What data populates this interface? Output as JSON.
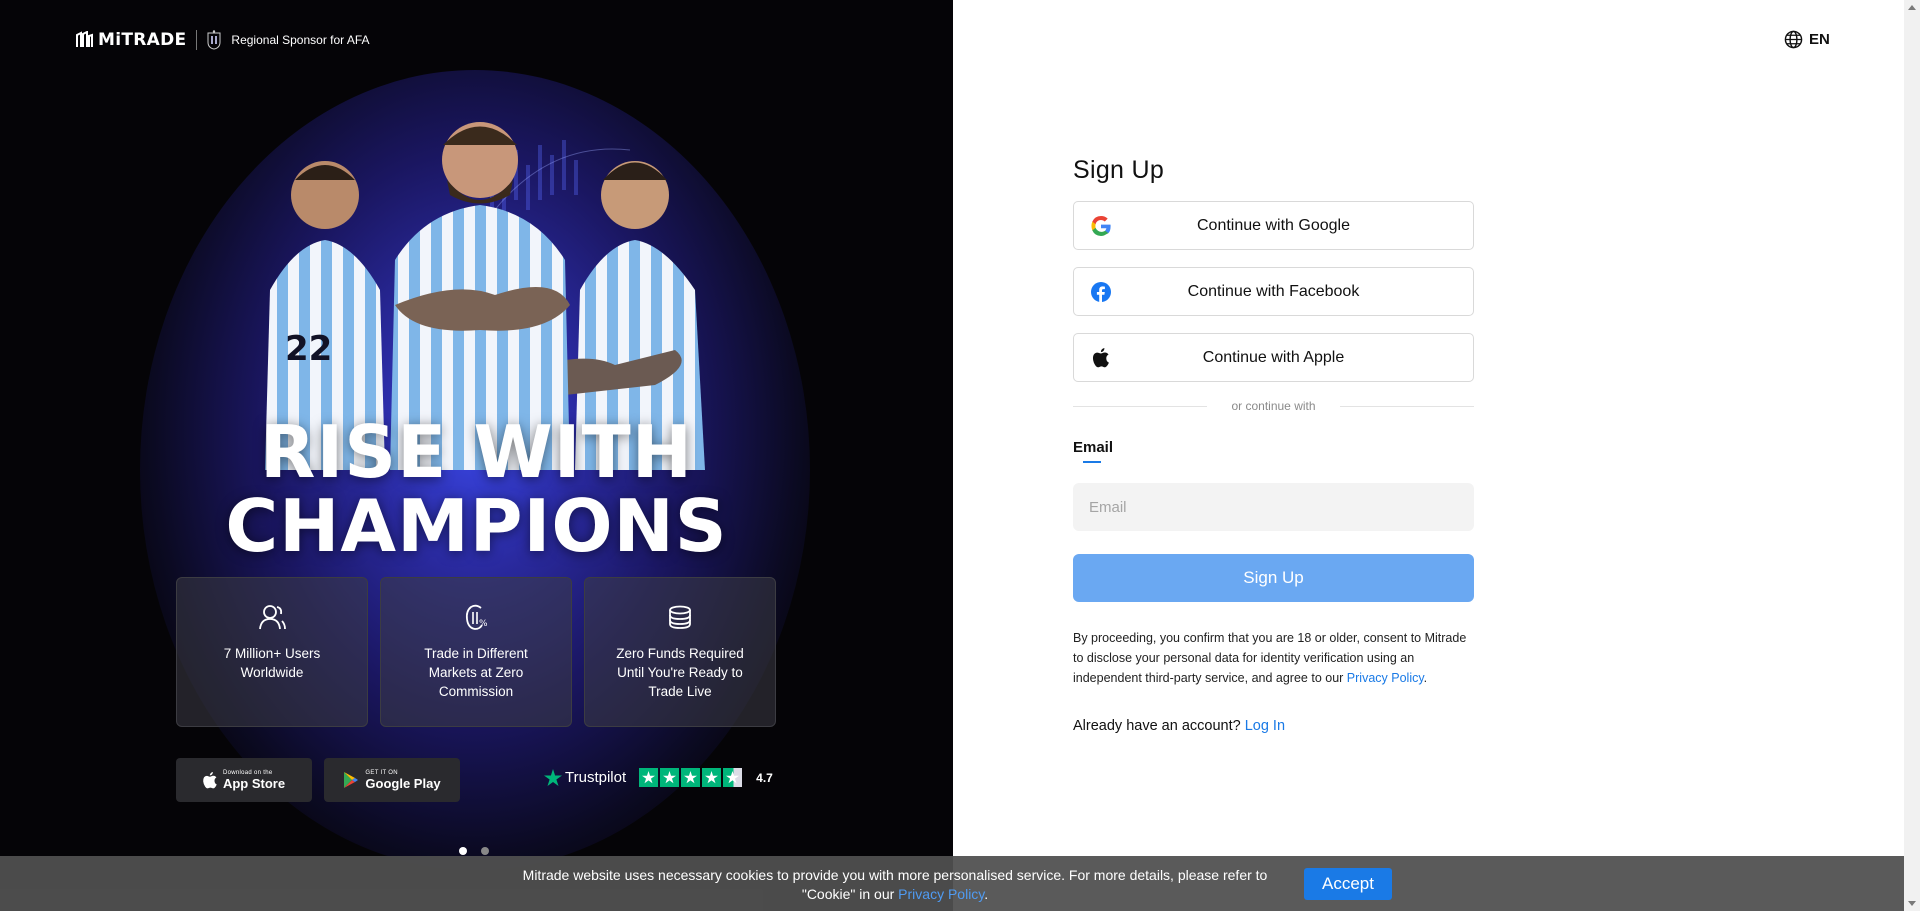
{
  "hero": {
    "brand_name": "MiTRADE",
    "sponsor_text": "Regional Sponsor for AFA",
    "headline_line1": "RISE WITH",
    "headline_line2": "CHAMPIONS",
    "features": [
      {
        "icon": "users-icon",
        "text": "7 Million+ Users Worldwide"
      },
      {
        "icon": "zero-commission-icon",
        "text": "Trade in Different Markets at Zero Commission"
      },
      {
        "icon": "coin-stack-icon",
        "text": "Zero Funds Required Until You're Ready to Trade Live"
      }
    ],
    "app_store": {
      "small": "Download on the",
      "big": "App Store"
    },
    "google_play": {
      "small": "GET IT ON",
      "big": "Google Play"
    },
    "trustpilot": {
      "name": "Trustpilot",
      "rating": "4.7",
      "stars": 4.5
    },
    "carousel": {
      "active_index": 0,
      "count": 2
    }
  },
  "header": {
    "language": "EN"
  },
  "form": {
    "title": "Sign Up",
    "google_label": "Continue with Google",
    "facebook_label": "Continue with Facebook",
    "apple_label": "Continue with Apple",
    "divider_text": "or continue with",
    "email_tab": "Email",
    "email_placeholder": "Email",
    "email_value": "",
    "submit_label": "Sign Up",
    "consent_text": "By proceeding, you confirm that you are 18 or older, consent to Mitrade to disclose your personal data for identity verification using an independent third-party service, and agree to our",
    "privacy_link": "Privacy Policy",
    "consent_end": ".",
    "login_prompt": "Already have an account?",
    "login_link": "Log In"
  },
  "cookie": {
    "text_part1": "Mitrade website uses necessary cookies to provide you with more personalised service. For more details, please refer to \"Cookie\" in our",
    "privacy_link": "Privacy Policy",
    "text_end": ".",
    "accept_label": "Accept"
  },
  "colors": {
    "primary": "#1a7ae6",
    "signup_button": "#6aa8f2",
    "trustpilot_green": "#00b67a",
    "hero_background": "#050407"
  }
}
